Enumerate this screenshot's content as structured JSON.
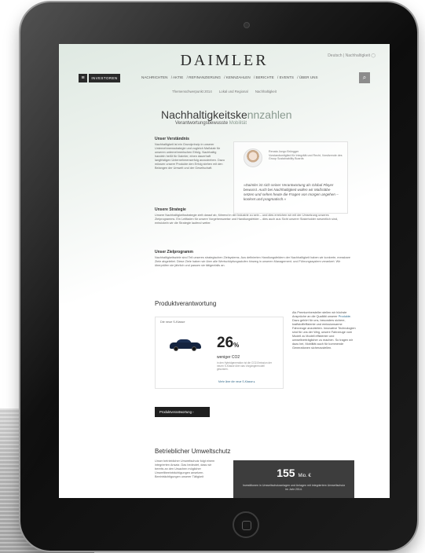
{
  "header": {
    "logo": "DAIMLER",
    "lang": "Deutsch | Nachhaltigkeit ◯",
    "menu_icon": "menu-icon",
    "investor_label": "INVESTOREN",
    "nav": [
      "NACHRICHTEN",
      "/ AKTIE",
      "/ REFINANZIERUNG",
      "/ KENNZAHLEN",
      "/ BERICHTE",
      "/ EVENTS",
      "/ ÜBER UNS"
    ],
    "search_icon": "search-icon",
    "subnav": [
      "Themenschwerpunkt 2014",
      "Lokal und Regional",
      "Nachhaltigkeit"
    ]
  },
  "hero": {
    "title_dark": "Nachhaltigkeitske",
    "title_light": "nnzahlen",
    "subtitle_dark": "Verantwortungsbewusste ",
    "subtitle_light": "Mobilität"
  },
  "sections": {
    "verstaendnis": {
      "heading": "Unser Verständnis",
      "text": "Nachhaltigkeit ist ein Grundprinzip in unserer Unternehmensstrategie und zugleich Maßstab für unseren unternehmerischen Erfolg. Nachhaltig handeln heißt für Daimler, einen dauerhaft langfristigen Unternehmenserfolg anzustreben. Dazu müssen unsere Produkte den Erfolg stehen mit den Belangen der Umwelt und der Gesellschaft."
    },
    "strategie": {
      "heading": "Unsere Strategie",
      "text": "Unsere Nachhaltigkeitsstrategie zielt darauf ab, führend in der Industrie zu sein – und dies erreichen wir mit der Umsetzung unseres Zielprogramms. Ein Leitfaden für unsere Vorgehensweise und Handlungsfelder – dies auch aus Sicht unserer Stakeholder wesentlich sind, entwickeln wir die Strategie laufend weiter."
    },
    "zielprogramm": {
      "heading": "Unser Zielprogramm",
      "text": "Nachhaltigkeitsziele sind Teil unseres strategischen Zielsystems. Aus definierten Handlungsfeldern der Nachhaltigkeit haben wir konkrete, messbare Ziele abgeleitet. Diese Ziele haben wir über alle Wertschöpfungsstufen hinweg in unseren Management- und Führungssystem verankert. Wir überprüfen sie jährlich und passen sie tätigenfalls an."
    }
  },
  "quote": {
    "name": "Renata Jungo Brüngger",
    "role": "Vorstandsmitglied für Integrität und Recht, Vorsitzende des Group Sustainability Boards",
    "text": "»Daimler ist sich seiner Verantwortung als Global Player bewusst. Auch bei Nachhaltigkeit wollen wir Maßstäbe setzen und sehen heute die Fragen von morgen angehen – konkret und pragmatisch.«"
  },
  "product": {
    "heading": "Produktverantwortung",
    "label": "Die neue S-Klasse",
    "value": "26",
    "unit": "%",
    "less": "weniger CO2",
    "note": "in den Hybridgeneration ist die CO2-Emission der neuen S-Klasse über das Vorgängermodell gesunken.",
    "link": "Mehr über die neue S-Klasse ▸",
    "side_text_1": "Als Premiumhersteller stellen wir höchste Ansprüche an die Qualität unserer ",
    "side_text_hl": "Produkte",
    "side_text_2": ". Dazu gehört für uns, besonders sichere, kraftstoffeffiziente und emissionsarme Fahrzeuge anzubieten. Innovative Technologien sind für uns der Weg, unsere Fahrzeuge vom Modell zu Modell effizienter und umweltverträglicher zu machen. So tragen wir dazu bei, Mobilität auch für kommende Generationen sicherzustellen.",
    "button": "Produktverantwortung  ›"
  },
  "umwelt": {
    "heading": "Betrieblicher Umweltschutz",
    "text": "Unser betrieblicher Umweltschutz folgt einem integrierten Ansatz. Das bedeutet, dass wir bereits an den Ursachen möglicher Umweltbeeinträchtigungen ansetzen. Beeinträchtigungen unserer Tätigkeit",
    "value": "155",
    "unit": "Mio. €",
    "caption": "Investitionen in Umweltschutzanlagen und Anlagen mit integriertem Umweltschutz im Jahr 2014."
  },
  "colors": {
    "accent_green": "#8a9a90",
    "dark": "#1f1f1f",
    "link_blue": "#3a6e8e"
  }
}
